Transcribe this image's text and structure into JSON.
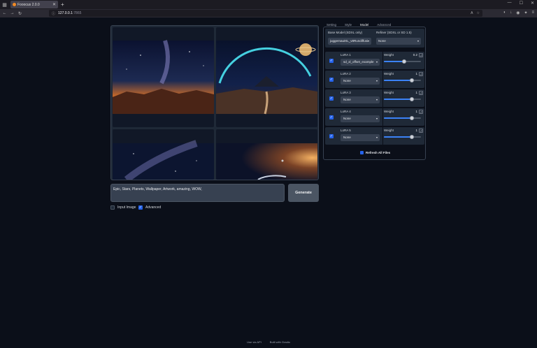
{
  "browser": {
    "tab_title": "Fooocus 2.0.0",
    "url_host": "127.0.0.1",
    "url_path": ":7865"
  },
  "prompt": {
    "value": "Epic, Stars, Planets, Wallpaper, Artwork, amazing, WOW,"
  },
  "generate_label": "Generate",
  "options": {
    "input_image_label": "Input Image",
    "input_image_checked": false,
    "advanced_label": "Advanced",
    "advanced_checked": true
  },
  "panel_tabs": [
    "Setting",
    "Style",
    "Model",
    "Advanced"
  ],
  "active_tab": "Model",
  "models": {
    "base_label": "Base Model (SDXL only)",
    "base_value": "juggernautXL_v8Rundiffusi",
    "refiner_label": "Refiner (SDXL or SD 1.5)",
    "refiner_value": "None"
  },
  "loras": [
    {
      "label": "LoRA 1",
      "value": "sd_xl_offset_example",
      "weight_label": "Weight",
      "weight": "0.2",
      "weight_frac": 0.55,
      "enabled": true
    },
    {
      "label": "LoRA 2",
      "value": "None",
      "weight_label": "Weight",
      "weight": "1",
      "weight_frac": 0.75,
      "enabled": true
    },
    {
      "label": "LoRA 3",
      "value": "None",
      "weight_label": "Weight",
      "weight": "1",
      "weight_frac": 0.75,
      "enabled": true
    },
    {
      "label": "LoRA 4",
      "value": "None",
      "weight_label": "Weight",
      "weight": "1",
      "weight_frac": 0.75,
      "enabled": true
    },
    {
      "label": "LoRA 5",
      "value": "None",
      "weight_label": "Weight",
      "weight": "1",
      "weight_frac": 0.75,
      "enabled": true
    }
  ],
  "refresh_label": "Refresh All Files",
  "footer": {
    "api": "Use via API",
    "built": "Built with Gradio"
  },
  "colors": {
    "background": "#0b0f19",
    "panel": "#1f2937",
    "accent": "#2563eb"
  }
}
